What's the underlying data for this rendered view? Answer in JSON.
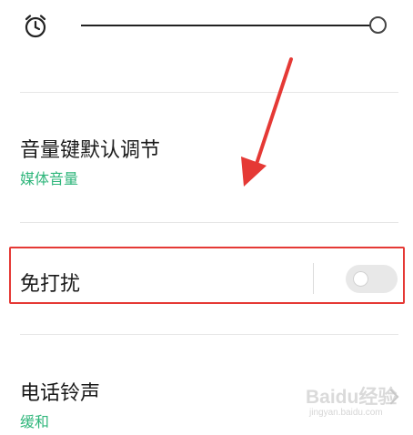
{
  "alarm_volume": {
    "icon": "alarm-clock-icon",
    "level": 1.0
  },
  "volume_key_setting": {
    "title": "音量键默认调节",
    "value": "媒体音量"
  },
  "do_not_disturb": {
    "title": "免打扰",
    "enabled": false
  },
  "ringtone": {
    "title": "电话铃声",
    "value": "缓和",
    "chevron_icon": "chevron-right-icon"
  },
  "watermark": {
    "text": "Baidu经验",
    "url": "jingyan.baidu.com"
  },
  "colors": {
    "accent_green": "#2fb67b",
    "highlight_red": "#e53935",
    "arrow_red": "#e53935"
  }
}
